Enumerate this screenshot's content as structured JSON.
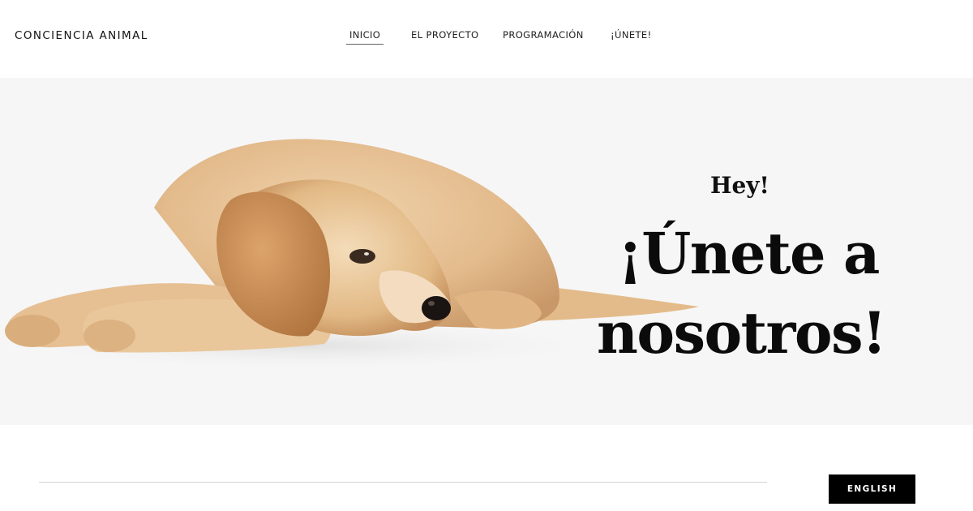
{
  "brand": {
    "name": "CONCIENCIA ANIMAL"
  },
  "nav": {
    "items": [
      {
        "label": "INICIO",
        "active": true
      },
      {
        "label": "EL PROYECTO"
      },
      {
        "label": "PROGRAMACIÓN"
      },
      {
        "label": "¡ÚNETE!"
      }
    ]
  },
  "hero": {
    "kicker": "Hey!",
    "headline_line1": "¡Únete a",
    "headline_line2": "nosotros!",
    "image": "puppy-lying-down"
  },
  "footer": {
    "language_button": "ENGLISH"
  },
  "colors": {
    "hero_bg": "#f6f6f7",
    "button_bg": "#000000",
    "text": "#111111"
  }
}
